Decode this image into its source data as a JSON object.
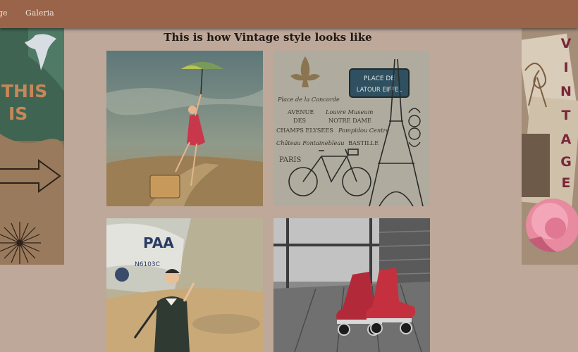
{
  "nav": {
    "items": [
      "ge",
      "Galeria"
    ]
  },
  "page": {
    "heading": "This is how Vintage style looks like"
  },
  "banners": {
    "left": {
      "words": [
        "THIS",
        "IS"
      ]
    },
    "right": {
      "letters": [
        "V",
        "I",
        "N",
        "T",
        "A",
        "G",
        "E"
      ]
    }
  },
  "gallery": {
    "paris": {
      "sign_lines": [
        "PLACE DE",
        "LATOUR EIFFEL"
      ],
      "texts": [
        "Place de la Concorde",
        "AVENUE",
        "Louvre Museum",
        "DES",
        "NOTRE DAME",
        "CHAMPS ELYSEES",
        "Pompidou Centre",
        "Château Fontainebleau",
        "BASTILLE",
        "PARIS"
      ]
    },
    "plane": {
      "texts": [
        "PAA",
        "N6103C"
      ]
    }
  },
  "colors": {
    "background": "#bea89a",
    "navbar": "#99644a",
    "nav_text": "#f2e2d6",
    "heading": "#1f1812"
  }
}
